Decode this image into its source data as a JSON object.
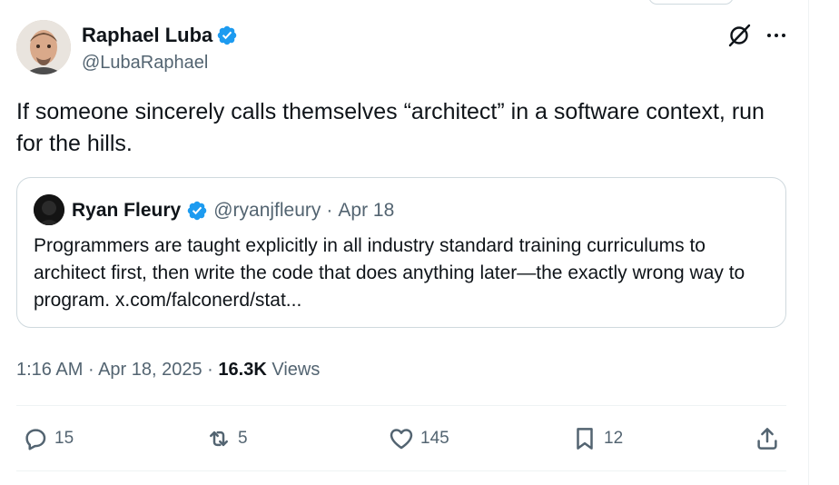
{
  "author": {
    "name": "Raphael Luba",
    "handle": "@LubaRaphael",
    "verified": true
  },
  "tweet": {
    "text": "If someone sincerely calls themselves “architect” in a software context, run for the hills."
  },
  "quote": {
    "name": "Ryan Fleury",
    "handle": "@ryanjfleury",
    "separator": "·",
    "date": "Apr 18",
    "text": "Programmers are taught explicitly in all industry standard training curriculums to architect first, then write the code that does anything later—the exactly wrong way to program. x.com/falconerd/stat..."
  },
  "meta": {
    "time": "1:16 AM",
    "separator": "·",
    "date": "Apr 18, 2025",
    "separator2": "·",
    "views_count": "16.3K",
    "views_label": "Views"
  },
  "actions": {
    "replies": "15",
    "reposts": "5",
    "likes": "145",
    "bookmarks": "12"
  },
  "icons": {
    "verified": "verified-badge-icon",
    "grok": "grok-icon",
    "more": "more-icon",
    "reply": "reply-icon",
    "repost": "repost-icon",
    "like": "like-icon",
    "bookmark": "bookmark-icon",
    "share": "share-icon"
  },
  "colors": {
    "verified_blue": "#1d9bf0",
    "secondary_text": "#536471",
    "primary_text": "#0f1419",
    "border": "#cfd9de"
  }
}
